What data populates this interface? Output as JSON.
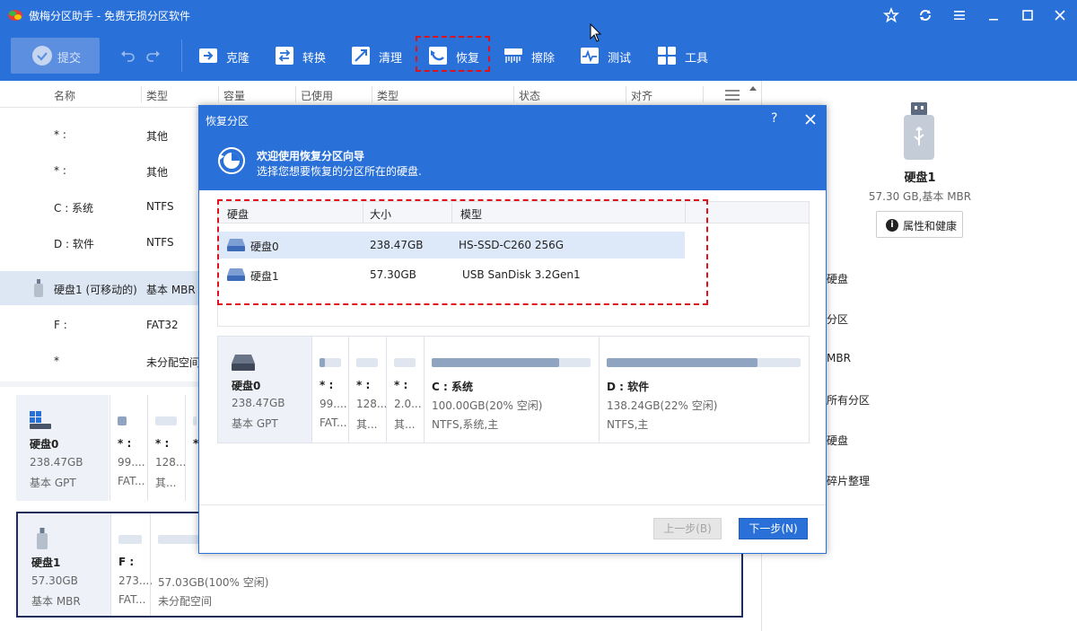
{
  "app": {
    "title": "傲梅分区助手 - 免费无损分区软件"
  },
  "toolbar": {
    "submit_label": "提交",
    "tools": [
      {
        "label": "克隆",
        "icon": "clone-icon"
      },
      {
        "label": "转换",
        "icon": "convert-icon"
      },
      {
        "label": "清理",
        "icon": "clean-icon"
      },
      {
        "label": "恢复",
        "icon": "recover-icon"
      },
      {
        "label": "擦除",
        "icon": "wipe-icon"
      },
      {
        "label": "测试",
        "icon": "test-icon"
      },
      {
        "label": "工具",
        "icon": "tools-icon"
      }
    ]
  },
  "table": {
    "headers": [
      "名称",
      "类型",
      "容量",
      "已使用",
      "类型",
      "状态",
      "对齐"
    ],
    "rows": [
      {
        "name": "* :",
        "type": "其他"
      },
      {
        "name": "* :",
        "type": "其他"
      },
      {
        "name": "C : 系统",
        "type": "NTFS"
      },
      {
        "name": "D : 软件",
        "type": "NTFS"
      },
      {
        "name": "硬盘1 (可移动的)",
        "type": "基本 MBR"
      },
      {
        "name": "F :",
        "type": "FAT32"
      },
      {
        "name": "*",
        "type": "未分配空间"
      }
    ]
  },
  "disk0_card": {
    "name": "硬盘0",
    "size": "238.47GB",
    "type": "基本 GPT",
    "parts": [
      {
        "name": "* :",
        "size": "99....",
        "fs": "FAT..."
      },
      {
        "name": "* :",
        "size": "128...",
        "fs": "其..."
      },
      {
        "name": "*",
        "size": "",
        "fs": ""
      }
    ]
  },
  "disk1_card": {
    "name": "硬盘1",
    "size": "57.30GB",
    "type": "基本 MBR",
    "parts": [
      {
        "name": "F :",
        "size": "273....",
        "fs": "FAT..."
      },
      {
        "name": "",
        "size": "57.03GB(100% 空闲)",
        "fs": "未分配空间"
      }
    ]
  },
  "right_panel": {
    "disk_name": "硬盘1",
    "disk_info": "57.30 GB,基本 MBR",
    "props_button": "属性和健康",
    "ops": [
      "硬盘",
      "分区",
      "MBR",
      "所有分区",
      "硬盘",
      "碎片整理"
    ]
  },
  "dialog": {
    "title": "恢复分区",
    "help": "?",
    "heading": "欢迎使用恢复分区向导",
    "subheading": "选择您想要恢复的分区所在的硬盘.",
    "columns": [
      "硬盘",
      "大小",
      "模型"
    ],
    "disks": [
      {
        "name": "硬盘0",
        "size": "238.47GB",
        "model": "HS-SSD-C260 256G"
      },
      {
        "name": "硬盘1",
        "size": "57.30GB",
        "model": "USB SanDisk 3.2Gen1"
      }
    ],
    "card": {
      "name": "硬盘0",
      "size": "238.47GB",
      "type": "基本 GPT",
      "parts": [
        {
          "name": "* :",
          "size": "99....",
          "fs": "FAT..."
        },
        {
          "name": "* :",
          "size": "128...",
          "fs": "其..."
        },
        {
          "name": "* :",
          "size": "2.0...",
          "fs": "其..."
        },
        {
          "name": "C : 系统",
          "size": "100.00GB(20% 空闲)",
          "fs": "NTFS,系统,主"
        },
        {
          "name": "D : 软件",
          "size": "138.24GB(22% 空闲)",
          "fs": "NTFS,主"
        }
      ]
    },
    "prev_button": "上一步(B)",
    "next_button": "下一步(N)"
  },
  "colors": {
    "accent": "#2a70d9",
    "highlight": "#e0111a"
  }
}
